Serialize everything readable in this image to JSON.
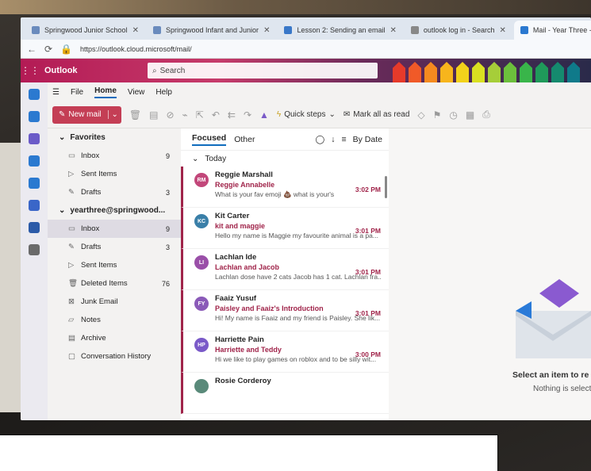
{
  "browser": {
    "tabs": [
      {
        "label": "Springwood Junior School",
        "active": false
      },
      {
        "label": "Springwood Infant and Junior",
        "active": false
      },
      {
        "label": "Lesson 2: Sending an email",
        "active": false
      },
      {
        "label": "outlook log in - Search",
        "active": false
      },
      {
        "label": "Mail - Year Three -",
        "active": true
      }
    ],
    "url": "https://outlook.cloud.microsoft/mail/"
  },
  "app": {
    "name": "Outlook",
    "search_placeholder": "Search"
  },
  "ribbon": {
    "tabs": [
      "File",
      "Home",
      "View",
      "Help"
    ],
    "active_tab": "Home",
    "new_mail_label": "New mail",
    "quick_steps_label": "Quick steps",
    "mark_all_read_label": "Mark all as read"
  },
  "folders": {
    "favorites_label": "Favorites",
    "favorites": [
      {
        "label": "Inbox",
        "count": "9",
        "icon": "inbox-icon"
      },
      {
        "label": "Sent Items",
        "count": "",
        "icon": "send-icon"
      },
      {
        "label": "Drafts",
        "count": "3",
        "icon": "pencil-icon"
      }
    ],
    "account_label": "yearthree@springwood...",
    "account": [
      {
        "label": "Inbox",
        "count": "9",
        "icon": "inbox-icon",
        "selected": true
      },
      {
        "label": "Drafts",
        "count": "3",
        "icon": "pencil-icon"
      },
      {
        "label": "Sent Items",
        "count": "",
        "icon": "send-icon"
      },
      {
        "label": "Deleted Items",
        "count": "76",
        "icon": "trash-icon"
      },
      {
        "label": "Junk Email",
        "count": "",
        "icon": "junk-icon"
      },
      {
        "label": "Notes",
        "count": "",
        "icon": "note-icon"
      },
      {
        "label": "Archive",
        "count": "",
        "icon": "archive-icon"
      },
      {
        "label": "Conversation History",
        "count": "",
        "icon": "folder-icon"
      }
    ]
  },
  "message_list": {
    "focused_label": "Focused",
    "other_label": "Other",
    "sort_label": "By Date",
    "group_label": "Today",
    "messages": [
      {
        "initials": "RM",
        "avatar_color": "#c2477a",
        "sender": "Reggie Marshall",
        "subject": "Reggie Annabelle",
        "preview": "What is your fav emoji 💩 what is your's",
        "time": "3:02 PM"
      },
      {
        "initials": "KC",
        "avatar_color": "#3a7fa8",
        "sender": "Kit Carter",
        "subject": "kit and maggie",
        "preview": "Hello my name is Maggie my favourite animal is a pa...",
        "time": "3:01 PM"
      },
      {
        "initials": "LI",
        "avatar_color": "#9a4fa8",
        "sender": "Lachlan Ide",
        "subject": "Lachlan and Jacob",
        "preview": "Lachlan dose have 2 cats Jacob has 1 cat. Lachlan fra...",
        "time": "3:01 PM"
      },
      {
        "initials": "FY",
        "avatar_color": "#8a5ab8",
        "sender": "Faaiz Yusuf",
        "subject": "Paisley and Faaiz's Introduction",
        "preview": "Hi! My name is Faaiz and my friend is Paisley. She lik...",
        "time": "3:01 PM"
      },
      {
        "initials": "HP",
        "avatar_color": "#7a5ac8",
        "sender": "Harriette Pain",
        "subject": "Harriette and Teddy",
        "preview": "Hi we like to play games on roblox and to be silly wit...",
        "time": "3:00 PM"
      },
      {
        "initials": "",
        "avatar_color": "#5a8a7a",
        "sender": "Rosie Corderoy",
        "subject": "",
        "preview": "",
        "time": ""
      }
    ]
  },
  "reading_pane": {
    "title": "Select an item to re",
    "subtitle": "Nothing is selected"
  },
  "colors": {
    "brand": "#c43e55",
    "accent": "#0f6cbd",
    "unread": "#a0244a"
  }
}
